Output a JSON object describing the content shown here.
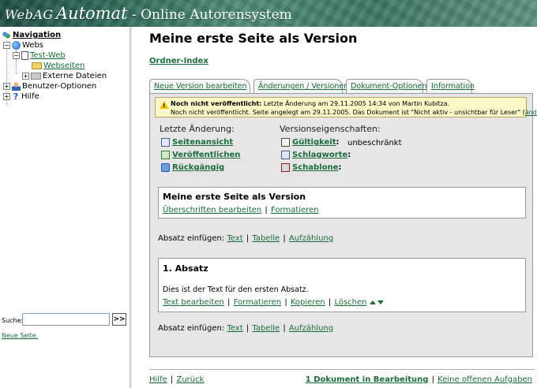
{
  "app": {
    "brand_1": "WebAG",
    "brand_2": "Automat",
    "brand_3": " - Online Autorensystem"
  },
  "sidebar": {
    "tree": [
      {
        "label": "Navigation",
        "icon": "navigation-icon"
      },
      {
        "label": "Webs",
        "icon": "globe-icon"
      },
      {
        "label": "Test-Web",
        "icon": "document-icon"
      },
      {
        "label": "Webseiten",
        "icon": "folder-icon"
      },
      {
        "label": "Externe Dateien",
        "icon": "folder-icon"
      },
      {
        "label": "Benutzer-Optionen",
        "icon": "user-icon"
      },
      {
        "label": "Hilfe",
        "icon": "help-icon"
      }
    ],
    "search_label": "Suche:",
    "search_value": "",
    "search_button": ">>",
    "new_page_link": "Neue Seite."
  },
  "main": {
    "title": "Meine erste Seite als Version",
    "ordner_index": "Ordner-Index",
    "tabs": [
      {
        "label": "Neue Version bearbeiten",
        "active": true
      },
      {
        "label": "Änderungen / Versionen",
        "active": false
      },
      {
        "label": "Dokument-Optionen",
        "active": false
      },
      {
        "label": "Information",
        "active": false
      }
    ],
    "warning": {
      "bold": "Noch nicht veröffentlicht:",
      "line1": " Letzte Änderung am 29.11.2005 14:34 von Martin Kubitza.",
      "line2": "Noch nicht veröffentlicht. Seite angelegt am 29.11.2005.    Das Dokument ist \"Nicht aktiv - unsichtbar für Leser\" (",
      "link": "ändern",
      "line2_end": ")."
    },
    "last_change_title": "Letzte Änderung:",
    "actions": [
      "Seitenansicht",
      "Veröffentlichen",
      "Rückgängig"
    ],
    "props_title": "Versionseigenschaften:",
    "props": [
      {
        "label": "Gültigkeit",
        "value": "unbeschränkt"
      },
      {
        "label": "Schlagworte",
        "value": ""
      },
      {
        "label": "Schablone",
        "value": ""
      }
    ],
    "header_card": {
      "title": "Meine erste Seite als Version",
      "link1": "Überschriften bearbeiten",
      "link2": "Formatieren"
    },
    "insert": {
      "label": "Absatz einfügen: ",
      "text": "Text",
      "table": "Tabelle",
      "list": "Aufzählung"
    },
    "paragraph_card": {
      "title": "1. Absatz",
      "text": "Dies ist der Text für den ersten Absatz.",
      "links": [
        "Text bearbeiten",
        "Formatieren",
        "Kopieren",
        "Löschen"
      ]
    }
  },
  "footer": {
    "help": "Hilfe",
    "back": "Zurück",
    "docs": "1 Dokument in Bearbeitung",
    "tasks": "Keine offenen Aufgaben"
  },
  "colors": {
    "link": "#1a6b3a",
    "warning_bg": "#fbf7c6",
    "panel_bg": "#e6e6e6"
  }
}
